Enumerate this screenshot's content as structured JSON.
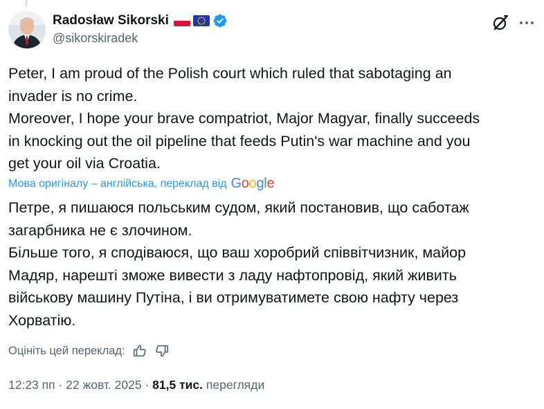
{
  "author": {
    "display_name": "Radosław Sikorski",
    "handle": "@sikorskiradek",
    "flags": [
      "poland-flag",
      "eu-flag"
    ],
    "verified": true
  },
  "tweet": {
    "text": "Peter, I am proud of the Polish court which ruled that sabotaging an\ninvader is no crime.\nMoreover, I hope your brave compatriot, Major Magyar, finally succeeds\nin knocking out the oil pipeline that feeds Putin's war machine and you\nget your oil via Croatia."
  },
  "translation": {
    "label": "Мова оригіналу – англійська, переклад від",
    "provider": "Google",
    "text": "Петре, я пишаюся польським судом, який постановив, що саботаж\nзагарбника не є злочином.\nБільше того, я сподіваюся, що ваш хоробрий співвітчизник, майор\nМадяр, нарешті зможе вивести з ладу нафтопровід, який живить\nвійськову машину Путіна, і ви отримуватимете свою нафту через\nХорватію.",
    "rate_label": "Оцініть цей переклад:"
  },
  "meta": {
    "time": "12:23 пп",
    "separator": " · ",
    "date": "22 жовт. 2025",
    "views_count": "81,5 тис.",
    "views_label": "перегляди"
  },
  "colors": {
    "accent": "#1d9bf0",
    "text": "#0f1419",
    "secondary": "#536471"
  }
}
